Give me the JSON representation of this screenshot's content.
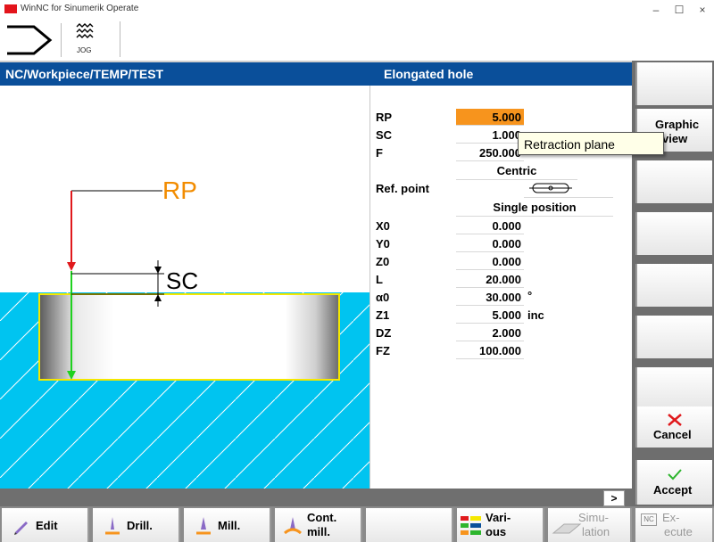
{
  "window": {
    "title": "WinNC for Sinumerik Operate",
    "minimize": "–",
    "maximize": "☐",
    "close": "×"
  },
  "toolbar": {
    "mode_label": "JOG"
  },
  "header": {
    "path": "NC/Workpiece/TEMP/TEST",
    "cycle_title": "Elongated hole"
  },
  "graphic": {
    "rp_label": "RP",
    "sc_label": "SC"
  },
  "params": {
    "rp": {
      "label": "RP",
      "value": "5.000"
    },
    "sc": {
      "label": "SC",
      "value": "1.000"
    },
    "f": {
      "label": "F",
      "value": "250.000"
    },
    "machining_mode": "Centric",
    "ref_point": {
      "label": "Ref. point"
    },
    "position_mode": "Single position",
    "x0": {
      "label": "X0",
      "value": "0.000"
    },
    "y0": {
      "label": "Y0",
      "value": "0.000"
    },
    "z0": {
      "label": "Z0",
      "value": "0.000"
    },
    "l": {
      "label": "L",
      "value": "20.000"
    },
    "a0": {
      "label": "α0",
      "value": "30.000",
      "unit": "°"
    },
    "z1": {
      "label": "Z1",
      "value": "5.000",
      "unit": "inc"
    },
    "dz": {
      "label": "DZ",
      "value": "2.000"
    },
    "fz": {
      "label": "FZ",
      "value": "100.000"
    }
  },
  "tooltip": "Retraction plane",
  "softkeys_right": {
    "graphic_view_1": "Graphic",
    "graphic_view_2": "view",
    "cancel": "Cancel",
    "accept": "Accept"
  },
  "more_button": ">",
  "softkeys_bottom": {
    "edit": "Edit",
    "drill": "Drill.",
    "mill": "Mill.",
    "cont_mill_1": "Cont.",
    "cont_mill_2": "mill.",
    "various_1": "Vari-",
    "various_2": "ous",
    "simulation_1": "Simu-",
    "simulation_2": "lation",
    "execute_1": "Ex-",
    "execute_2": "ecute",
    "execute_icon_text": "NC"
  },
  "colors": {
    "header_blue": "#0a4f9a",
    "active_field": "#f7941d",
    "workpiece_cyan": "#00c4f0",
    "outline_yellow": "#f5e800",
    "rp_orange": "#f28c00"
  }
}
